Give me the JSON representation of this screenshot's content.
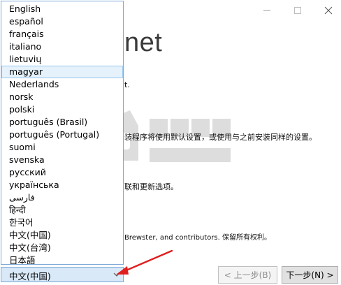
{
  "window": {
    "minimize_icon": "minimize-icon",
    "maximize_icon": "maximize-icon",
    "close_icon": "close-icon"
  },
  "background": {
    "title_fragment": "net",
    "lines": [
      "t.",
      "装程序将使用默认设置，或使用与之前安装同样的设置。",
      "联和更新选项。",
      "Brewster, and contributors. 保留所有权利。"
    ]
  },
  "language_list": {
    "items": [
      "English",
      "español",
      "français",
      "italiano",
      "lietuvių",
      "magyar",
      "Nederlands",
      "norsk",
      "polski",
      "português (Brasil)",
      "português (Portugal)",
      "suomi",
      "svenska",
      "русский",
      "українська",
      "فارسی",
      "हिन्दी",
      "한국어",
      "中文(中国)",
      "中文(台湾)",
      "日本語"
    ],
    "selected": "magyar"
  },
  "language_combo": {
    "value": "中文(中国)"
  },
  "buttons": {
    "prev_label": "< 上一步(B)",
    "next_label": "下一步(N) >"
  },
  "colors": {
    "list_border": "#7aa7d8",
    "selected_bg": "#e5f1fb",
    "combo_bg": "#d9e9f7",
    "arrow_red": "#e01e1e"
  }
}
